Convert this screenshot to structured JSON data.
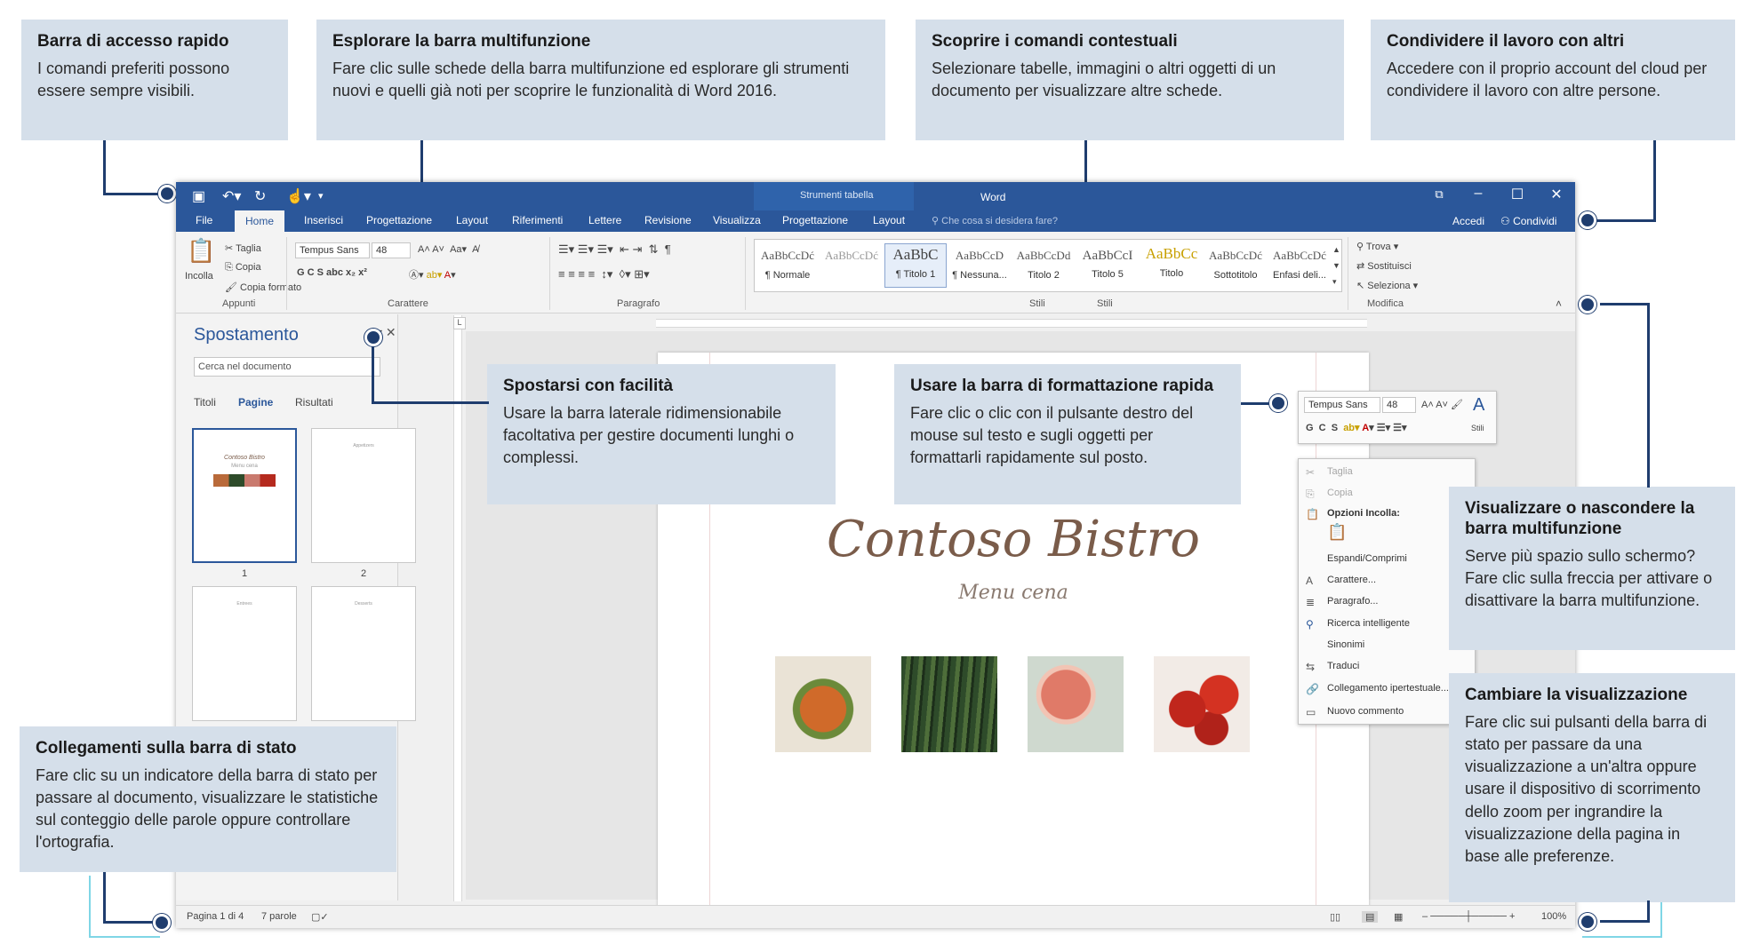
{
  "callouts": {
    "quick_access": {
      "title": "Barra di accesso rapido",
      "body": "I comandi preferiti possono essere sempre visibili."
    },
    "ribbon": {
      "title": "Esplorare la barra multifunzione",
      "body": "Fare clic sulle schede della barra multifunzione ed esplorare gli strumenti nuovi e quelli già noti per scoprire le funzionalità di Word 2016."
    },
    "contextual": {
      "title": "Scoprire i comandi contestuali",
      "body": "Selezionare tabelle, immagini o altri oggetti di un documento per visualizzare altre schede."
    },
    "share": {
      "title": "Condividere il lavoro con altri",
      "body": "Accedere con il proprio account del cloud per condividere il lavoro con altre persone."
    },
    "navigate": {
      "title": "Spostarsi con facilità",
      "body": "Usare la barra laterale ridimensionabile facoltativa per gestire documenti lunghi o complessi."
    },
    "minitoolbar": {
      "title": "Usare la barra di formattazione rapida",
      "body": "Fare clic o clic con il pulsante destro del mouse sul testo e sugli oggetti per formattarli rapidamente sul posto."
    },
    "showhide": {
      "title": "Visualizzare o nascondere la barra multifunzione",
      "body": "Serve più spazio sullo schermo? Fare clic sulla freccia per attivare o disattivare la barra multifunzione."
    },
    "statusbar": {
      "title": "Collegamenti sulla barra di stato",
      "body": "Fare clic su un indicatore della barra di stato per passare al documento, visualizzare le statistiche sul conteggio delle parole oppure controllare l'ortografia."
    },
    "views": {
      "title": "Cambiare la visualizzazione",
      "body": "Fare clic sui pulsanti della barra di stato per passare da una visualizzazione a un'altra oppure usare il dispositivo di scorrimento dello zoom per ingrandire la visualizzazione della pagina in base alle preferenze."
    }
  },
  "window": {
    "title": "Word",
    "context_label": "Strumenti tabella",
    "tell_me": "Che cosa si desidera fare?",
    "sign_in": "Accedi",
    "share": "Condividi"
  },
  "tabs": [
    "File",
    "Home",
    "Inserisci",
    "Progettazione",
    "Layout",
    "Riferimenti",
    "Lettere",
    "Revisione",
    "Visualizza",
    "Progettazione",
    "Layout"
  ],
  "ribbon": {
    "clipboard": {
      "paste": "Incolla",
      "cut": "Taglia",
      "copy": "Copia",
      "format_painter": "Copia formato",
      "label": "Appunti"
    },
    "font": {
      "name": "Tempus Sans",
      "size": "48",
      "label": "Carattere",
      "row2": "G  C  S  abc  x₂  x²"
    },
    "paragraph": {
      "label": "Paragrafo"
    },
    "styles": {
      "label": "Stili",
      "label2": "Stili",
      "items": [
        {
          "preview": "AaBbCcDć",
          "name": "¶ Normale"
        },
        {
          "preview": "AaBbCcDć",
          "name": ""
        },
        {
          "preview": "AaBbC",
          "name": "¶ Titolo 1"
        },
        {
          "preview": "AaBbCcD",
          "name": "¶ Nessuna..."
        },
        {
          "preview": "AaBbCcDd",
          "name": "Titolo 2"
        },
        {
          "preview": "AaBbCcI",
          "name": "Titolo 5"
        },
        {
          "preview": "AaBbCc",
          "name": "Titolo"
        },
        {
          "preview": "AaBbCcDć",
          "name": "Sottotitolo"
        },
        {
          "preview": "AaBbCcDć",
          "name": "Enfasi deli..."
        }
      ]
    },
    "editing": {
      "find": "Trova",
      "replace": "Sostituisci",
      "select": "Seleziona",
      "label": "Modifica"
    }
  },
  "nav": {
    "title": "Spostamento",
    "search_placeholder": "Cerca nel documento",
    "tabs": [
      "Titoli",
      "Pagine",
      "Risultati"
    ],
    "pages": [
      "1",
      "2"
    ],
    "thumb_titles": [
      "Contoso Bistro",
      "Appetizers",
      "Entrees",
      "Desserts"
    ],
    "thumb_sub": "Menu cena"
  },
  "document": {
    "title": "Contoso Bistro",
    "subtitle": "Menu cena"
  },
  "minitoolbar": {
    "font": "Tempus Sans",
    "size": "48",
    "styles": "Stili"
  },
  "context_menu": {
    "cut": "Taglia",
    "copy": "Copia",
    "paste_options": "Opzioni Incolla:",
    "expand": "Espandi/Comprimi",
    "font": "Carattere...",
    "paragraph": "Paragrafo...",
    "smart_lookup": "Ricerca intelligente",
    "synonyms": "Sinonimi",
    "translate": "Traduci",
    "hyperlink": "Collegamento ipertestuale...",
    "new_comment": "Nuovo commento"
  },
  "statusbar": {
    "page": "Pagina 1 di 4",
    "words": "7 parole",
    "zoom": "100%"
  },
  "colors": {
    "word_blue": "#2b579a",
    "callout_bg": "#d5dfea",
    "connector": "#1f3d6e"
  }
}
